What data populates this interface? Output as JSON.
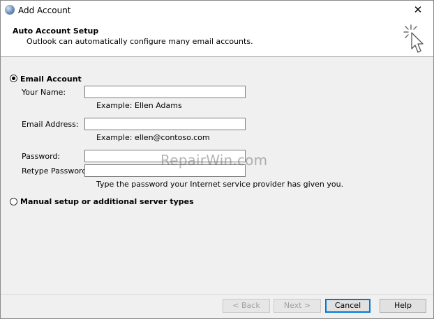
{
  "window": {
    "title": "Add Account",
    "close_glyph": "✕"
  },
  "header": {
    "title": "Auto Account Setup",
    "subtitle": "Outlook can automatically configure many email accounts.",
    "icon": "wizard-cursor-icon"
  },
  "email_account": {
    "label": "Email Account",
    "selected": true,
    "your_name": {
      "label": "Your Name:",
      "value": "",
      "example": "Example: Ellen Adams"
    },
    "email_address": {
      "label": "Email Address:",
      "value": "",
      "example": "Example: ellen@contoso.com"
    },
    "password": {
      "label": "Password:",
      "value": ""
    },
    "retype_password": {
      "label": "Retype Password:",
      "value": ""
    },
    "password_hint": "Type the password your Internet service provider has given you."
  },
  "manual_setup": {
    "label": "Manual setup or additional server types",
    "selected": false
  },
  "watermark": "RepairWin.com",
  "footer": {
    "back": "< Back",
    "next": "Next >",
    "cancel": "Cancel",
    "help": "Help"
  }
}
